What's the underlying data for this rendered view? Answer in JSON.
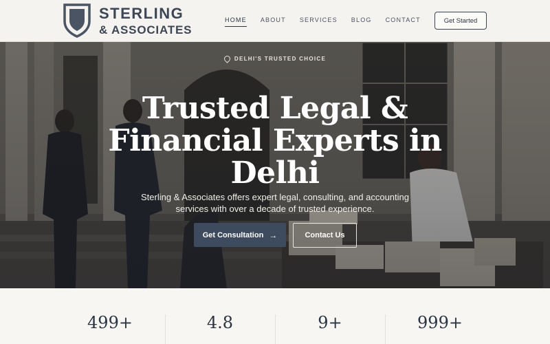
{
  "brand": {
    "name_line1": "STERLING",
    "name_line2": "& ASSOCIATES",
    "logo_icon": "shield-icon"
  },
  "nav": {
    "items": [
      {
        "label": "HOME",
        "active": true
      },
      {
        "label": "ABOUT",
        "active": false
      },
      {
        "label": "SERVICES",
        "active": false
      },
      {
        "label": "BLOG",
        "active": false
      },
      {
        "label": "CONTACT",
        "active": false
      }
    ],
    "cta_label": "Get Started"
  },
  "hero": {
    "eyebrow": "DELHI'S TRUSTED CHOICE",
    "eyebrow_icon": "map-pin-icon",
    "title": "Trusted Legal & Financial Experts in Delhi",
    "subtitle": "Sterling & Associates offers expert legal, consulting, and accounting services with over a decade of trusted experience.",
    "primary_button": "Get Consultation",
    "primary_button_icon": "arrow-right-icon",
    "secondary_button": "Contact Us"
  },
  "stats": [
    {
      "value": "499+"
    },
    {
      "value": "4.8"
    },
    {
      "value": "9+"
    },
    {
      "value": "999+"
    }
  ],
  "colors": {
    "brand_dark": "#3d4654",
    "primary_button": "#3e4a5e",
    "background": "#f7f6f2"
  }
}
